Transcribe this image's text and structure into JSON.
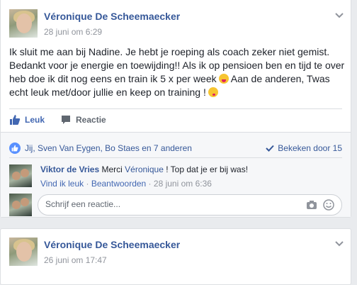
{
  "post1": {
    "author": "Véronique De Scheemaecker",
    "timestamp": "28 juni om 6:29",
    "text_part1": "Ik sluit me aan bij Nadine. Je hebt je roeping als coach zeker niet gemist. Bedankt voor je energie en toewijding!! Als ik op pensioen ben en tijd te over heb doe ik dit nog eens en train ik 5 x per week",
    "text_part2": " Aan de anderen, Twas echt leuk met/door jullie en keep on training !",
    "actions": {
      "like": "Leuk",
      "comment": "Reactie"
    },
    "likes_summary": "Jij, Sven Van Eygen, Bo Staes en 7 anderen",
    "seen_by": "Bekeken door 15",
    "comment": {
      "author": "Viktor de Vries",
      "text_before": " Merci ",
      "mention": "Véronique",
      "text_after": " ! Top dat je er bij was!",
      "like_link": "Vind ik leuk",
      "separator": " · ",
      "reply_link": "Beantwoorden",
      "timestamp": "28 juni om 6:36"
    },
    "reply_placeholder": "Schrijf een reactie..."
  },
  "post2": {
    "author": "Véronique De Scheemaecker",
    "timestamp": "26 juni om 17:47"
  },
  "colors": {
    "link": "#365899",
    "accent": "#4267b2",
    "like_badge": "#5890ff",
    "muted": "#90949c"
  },
  "icons": [
    "chevron-down-icon",
    "thumbs-up-icon",
    "comment-icon",
    "like-badge-icon",
    "checkmark-icon",
    "camera-icon",
    "smiley-icon",
    "emoji-tongue-icon",
    "emoji-kiss-icon"
  ]
}
